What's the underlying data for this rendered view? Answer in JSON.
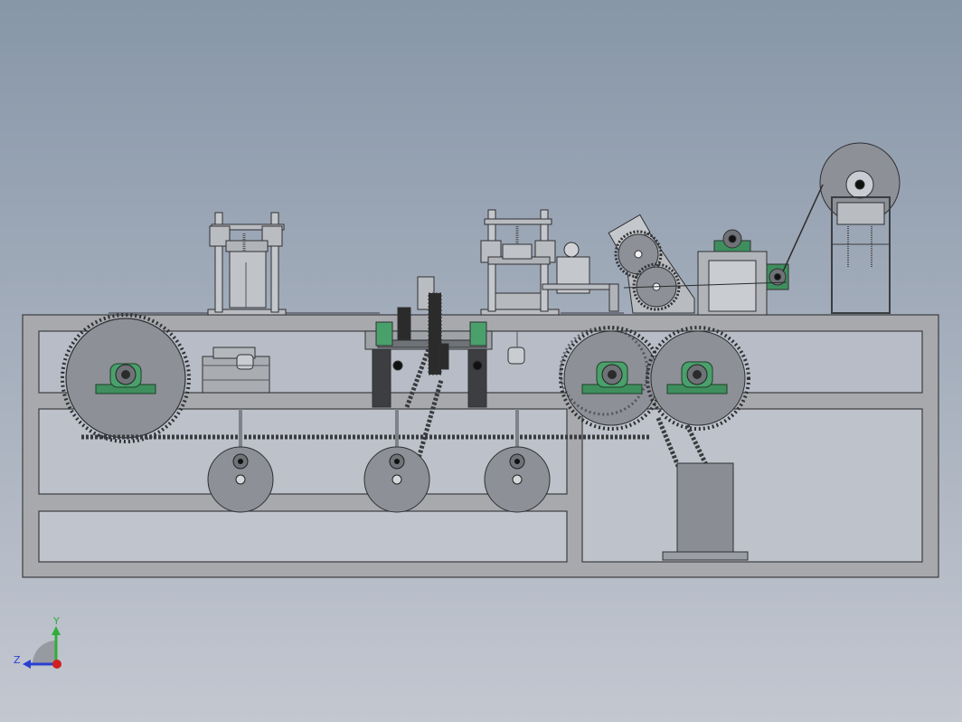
{
  "view": {
    "background_top": "#8796a8",
    "background_bottom": "#c3c7d0"
  },
  "colors": {
    "frame": "#a7a9ad",
    "frame_edge": "#3b3d40",
    "steel": "#b9bcc0",
    "dark_steel": "#6f7377",
    "sprocket": "#8d9096",
    "bearing_green": "#3f8f5e",
    "bearing_light": "#6fcf97",
    "motor": "#8a8e94",
    "gear_black": "#2b2b2b"
  },
  "triad": {
    "y_label": "Y",
    "z_label": "Z",
    "y_color": "#2fae3a",
    "z_color": "#2a3fd1",
    "x_dot_color": "#d0201f"
  }
}
